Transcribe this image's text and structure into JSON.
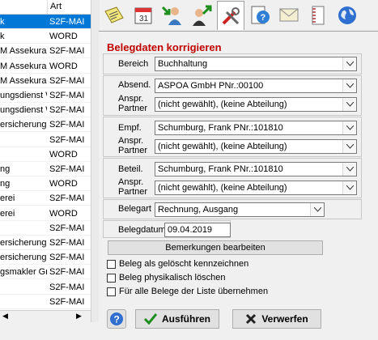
{
  "list": {
    "headers": [
      "",
      "Art"
    ],
    "rows": [
      {
        "c1": "k",
        "c2": "S2F-MAI",
        "selected": true
      },
      {
        "c1": "k",
        "c2": "WORD"
      },
      {
        "c1": "M Assekurar",
        "c2": "S2F-MAI"
      },
      {
        "c1": "M Assekurar",
        "c2": "WORD"
      },
      {
        "c1": "M Assekurar",
        "c2": "S2F-MAI"
      },
      {
        "c1": "ungsdienst W",
        "c2": "S2F-MAI"
      },
      {
        "c1": "ungsdienst W",
        "c2": "S2F-MAI"
      },
      {
        "c1": "ersicherungs",
        "c2": "S2F-MAI"
      },
      {
        "c1": "",
        "c2": "S2F-MAI"
      },
      {
        "c1": "",
        "c2": "WORD"
      },
      {
        "c1": "ng",
        "c2": "S2F-MAI"
      },
      {
        "c1": "ng",
        "c2": "WORD"
      },
      {
        "c1": "erei",
        "c2": "S2F-MAI"
      },
      {
        "c1": "erei",
        "c2": "WORD"
      },
      {
        "c1": "",
        "c2": "S2F-MAI"
      },
      {
        "c1": "ersicherungs",
        "c2": "S2F-MAI"
      },
      {
        "c1": "ersicherungs",
        "c2": "S2F-MAI"
      },
      {
        "c1": "gsmakler Gmb",
        "c2": "S2F-MAI"
      },
      {
        "c1": "",
        "c2": "S2F-MAI"
      },
      {
        "c1": "",
        "c2": "S2F-MAI"
      }
    ]
  },
  "toolbar": {
    "tabs": [
      "notes-icon",
      "calendar-icon",
      "user-arrow-in-icon",
      "user-arrow-out-icon",
      "tools-icon",
      "help-document-icon",
      "mail-envelope-icon",
      "document-spiral-icon",
      "globe-icon"
    ]
  },
  "form": {
    "title": "Belegdaten korrigieren",
    "bereich_label": "Bereich",
    "bereich_value": "Buchhaltung",
    "absend_label": "Absend.",
    "absend_value": "ASPOA GmbH PNr.:00100",
    "anspr_label_1": "Anspr.",
    "anspr_label_2": "Partner",
    "partner_value": "(nicht gewählt),   (keine Abteilung)",
    "empf_label": "Empf.",
    "empf_value": "Schumburg, Frank PNr.:101810",
    "beteil_label": "Beteil.",
    "beteil_value": "Schumburg, Frank PNr.:101810",
    "belegart_label": "Belegart",
    "belegart_value": "Rechnung, Ausgang",
    "belegdatum_label": "Belegdatum",
    "belegdatum_value": "09.04.2019",
    "bemerkungen_button": "Bemerkungen bearbeiten",
    "check_geloescht": "Beleg als gelöscht kennzeichnen",
    "check_physisch": "Beleg physikalisch löschen",
    "check_alle": "Für alle Belege der Liste übernehmen",
    "ausfuehren_button": "Ausführen",
    "verwerfen_button": "Verwerfen"
  },
  "colors": {
    "title": "#c00000",
    "selection": "#0078d7",
    "ok_green": "#1e8e1e",
    "cancel_dark": "#222222"
  }
}
